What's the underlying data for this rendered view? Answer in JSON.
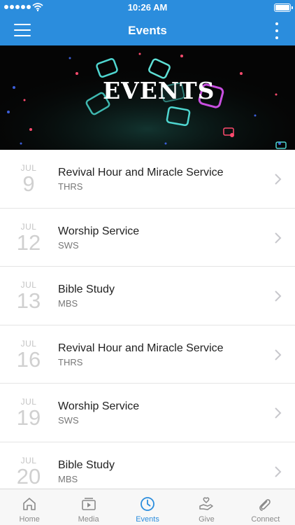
{
  "status_bar": {
    "time": "10:26 AM"
  },
  "nav": {
    "title": "Events"
  },
  "banner": {
    "text": "EVENTS"
  },
  "events": [
    {
      "month": "JUL",
      "day": "9",
      "name": "Revival Hour and Miracle Service",
      "code": "THRS"
    },
    {
      "month": "JUL",
      "day": "12",
      "name": "Worship Service",
      "code": "SWS"
    },
    {
      "month": "JUL",
      "day": "13",
      "name": "Bible Study",
      "code": "MBS"
    },
    {
      "month": "JUL",
      "day": "16",
      "name": "Revival Hour and Miracle Service",
      "code": "THRS"
    },
    {
      "month": "JUL",
      "day": "19",
      "name": "Worship Service",
      "code": "SWS"
    },
    {
      "month": "JUL",
      "day": "20",
      "name": "Bible Study",
      "code": "MBS"
    }
  ],
  "tabs": [
    {
      "label": "Home",
      "icon": "home-icon",
      "active": false
    },
    {
      "label": "Media",
      "icon": "media-icon",
      "active": false
    },
    {
      "label": "Events",
      "icon": "clock-icon",
      "active": true
    },
    {
      "label": "Give",
      "icon": "give-icon",
      "active": false
    },
    {
      "label": "Connect",
      "icon": "connect-icon",
      "active": false
    }
  ],
  "colors": {
    "accent": "#2b8ddd",
    "tab_inactive": "#8a8a8a"
  }
}
